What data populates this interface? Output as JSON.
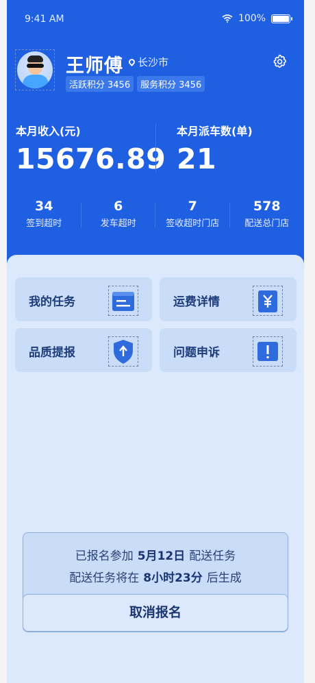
{
  "status_bar": {
    "time": "9:41 AM",
    "battery": "100%"
  },
  "profile": {
    "name": "王师傅",
    "city": "长沙市",
    "badges": [
      {
        "label": "活跃积分",
        "value": "3456"
      },
      {
        "label": "服务积分",
        "value": "3456"
      }
    ]
  },
  "summary": {
    "income_label": "本月收入(元)",
    "income_value": "15676.89",
    "dispatch_label": "本月派车数(单)",
    "dispatch_value": "21"
  },
  "metrics": [
    {
      "value": "34",
      "label": "签到超时"
    },
    {
      "value": "6",
      "label": "发车超时"
    },
    {
      "value": "7",
      "label": "签收超时门店"
    },
    {
      "value": "578",
      "label": "配送总门店"
    }
  ],
  "menu": [
    {
      "label": "我的任务",
      "icon": "task-icon"
    },
    {
      "label": "运费详情",
      "icon": "yen-icon"
    },
    {
      "label": "品质提报",
      "icon": "shield-upload-icon"
    },
    {
      "label": "问题申诉",
      "icon": "alert-icon"
    }
  ],
  "notice": {
    "line1_prefix": "已报名参加",
    "line1_date": "5月12日",
    "line1_suffix": "配送任务",
    "line2_prefix": "配送任务将在",
    "line2_time": "8小时23分",
    "line2_suffix": "后生成",
    "cancel_label": "取消报名"
  },
  "colors": {
    "header_blue": "#1f5fe1",
    "page_bg": "#dce8fb",
    "card_bg": "#c9dcf8",
    "text_dark": "#1f3d7a"
  }
}
